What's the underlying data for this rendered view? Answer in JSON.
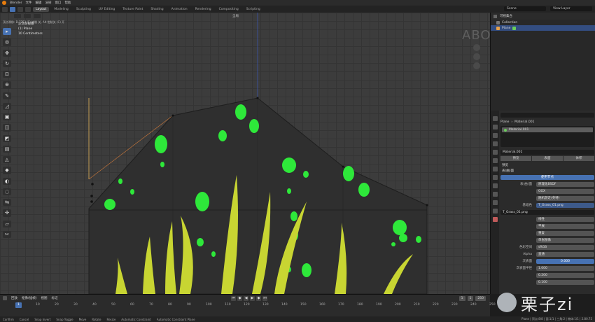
{
  "top_menu": {
    "app_name": "Blender",
    "items": [
      "文件",
      "编辑",
      "渲染",
      "窗口",
      "帮助"
    ]
  },
  "workspaces": {
    "tabs": [
      "Layout",
      "Modeling",
      "Sculpting",
      "UV Editing",
      "Texture Paint",
      "Shading",
      "Animation",
      "Rendering",
      "Compositing",
      "Scripting"
    ],
    "active": "Layout",
    "scene": "Scene",
    "view_layer": "View Layer"
  },
  "viewport": {
    "transform_orientation": "全局",
    "hint": "顶点滑移: D.7253 (F) 钳制 关, Alt 钳制关 (C) 开",
    "info_lines": [
      "正交前视图",
      "(1) Plane",
      "10 Centimeters"
    ],
    "watermark": "ABOUTCG.ORG"
  },
  "outliner": {
    "title": "可视集合",
    "rows": [
      {
        "label": "Collection",
        "selected": false
      },
      {
        "label": "Plane",
        "selected": true
      }
    ]
  },
  "properties": {
    "search_placeholder": "",
    "object_name": "Plane",
    "material_header": "Material.001",
    "slot": "Material.001",
    "material_datablock": "Material.001",
    "tabs": [
      "预览",
      "表面",
      "体积"
    ],
    "sections": [
      "预览",
      "表(曲)面"
    ],
    "use_nodes_btn": "使用节点",
    "surface_label": "表(曲)面",
    "surface_value": "原理化BSDF",
    "distribution": "GGX",
    "subsurface_method": "随机游走(英特)",
    "base_color_label": "基础色",
    "base_color_value": "T_Grass_01.png",
    "image_name": "T_Grass_01.png",
    "interp": "线性",
    "projection": "平展",
    "extension": "重复",
    "source": "单张图像",
    "color_space_label": "色彩空间",
    "color_space": "sRGB",
    "alpha_label": "Alpha",
    "alpha_value": "直通",
    "subsurface_label": "次表面",
    "subsurface_value": "0.000",
    "subsurface_radius_label": "次表面半径",
    "radius_values": [
      "1.000",
      "0.200",
      "0.100"
    ]
  },
  "timeline": {
    "menus": [
      "回放",
      "抠像(插帧)",
      "视图",
      "标记"
    ],
    "ruler": [
      "0",
      "10",
      "20",
      "30",
      "40",
      "50",
      "60",
      "70",
      "80",
      "90",
      "100",
      "110",
      "120",
      "130",
      "140",
      "150",
      "160",
      "170",
      "180",
      "190",
      "200",
      "210",
      "220",
      "230",
      "240",
      "250"
    ],
    "current_frame": "1",
    "start": "1",
    "end": "250"
  },
  "statusbar": {
    "items": [
      "Confirm",
      "Cancel",
      "Snap Invert",
      "Snap Toggle",
      "Move",
      "Rotate",
      "Resize",
      "Automatic Constraint",
      "Automatic Constraint Plane"
    ],
    "stats": "Plane | 顶点:8/8 | 面:1/1 | 三角:2 | 物体:1/1 | 2.80.75"
  },
  "logo_text": "栗子zi",
  "colors": {
    "accent_blue": "#4772b3",
    "mesh_dark": "#2f2f2f",
    "leaf_green": "#2ee83a",
    "grass_yellow": "#c8d532"
  }
}
